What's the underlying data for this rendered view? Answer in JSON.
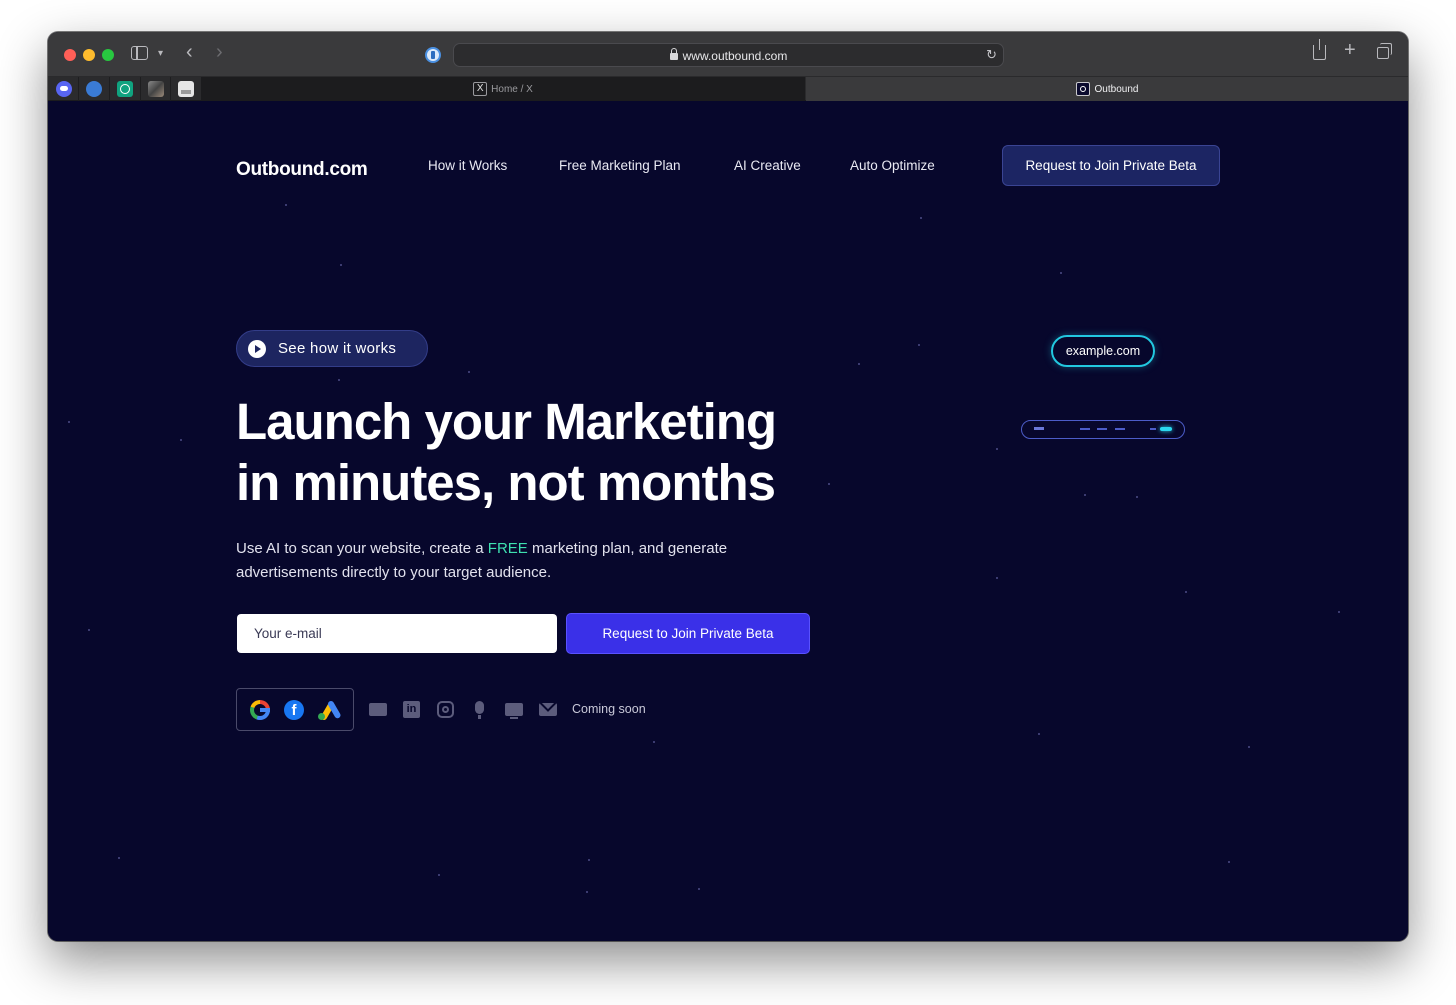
{
  "browser": {
    "url": "www.outbound.com",
    "tabs": [
      {
        "title": "Home / X",
        "favicon": "x-icon"
      },
      {
        "title": "Outbound",
        "favicon": "outbound-icon"
      }
    ],
    "pinned_tabs": [
      "discord-icon",
      "cloud-icon",
      "chatgpt-icon",
      "photo-icon",
      "doc-icon"
    ]
  },
  "site": {
    "logo": "Outbound.com",
    "nav": {
      "items": [
        "How it Works",
        "Free Marketing Plan",
        "AI Creative",
        "Auto Optimize"
      ],
      "cta": "Request to Join Private Beta"
    },
    "hero": {
      "see_how": "See how it works",
      "headline_line1": "Launch your Marketing",
      "headline_line2": "in minutes, not months",
      "sub_before": "Use AI to scan your website, create a ",
      "sub_free": "FREE",
      "sub_after": " marketing plan, and generate advertisements directly to your target audience.",
      "email_placeholder": "Your e-mail",
      "join_button": "Request to Join Private Beta"
    },
    "platforms": {
      "available": [
        "google-icon",
        "facebook-icon",
        "google-ads-icon"
      ],
      "coming_soon_icons": [
        "billboard-icon",
        "linkedin-icon",
        "instagram-icon",
        "podcast-mic-icon",
        "tv-icon",
        "email-icon"
      ],
      "coming_soon_label": "Coming soon"
    },
    "demo": {
      "domain": "example.com"
    }
  },
  "colors": {
    "page_bg": "#07072c",
    "accent_button": "#3a30e8",
    "free_highlight": "#3ee0b0",
    "scan_cyan": "#22c8e0"
  }
}
